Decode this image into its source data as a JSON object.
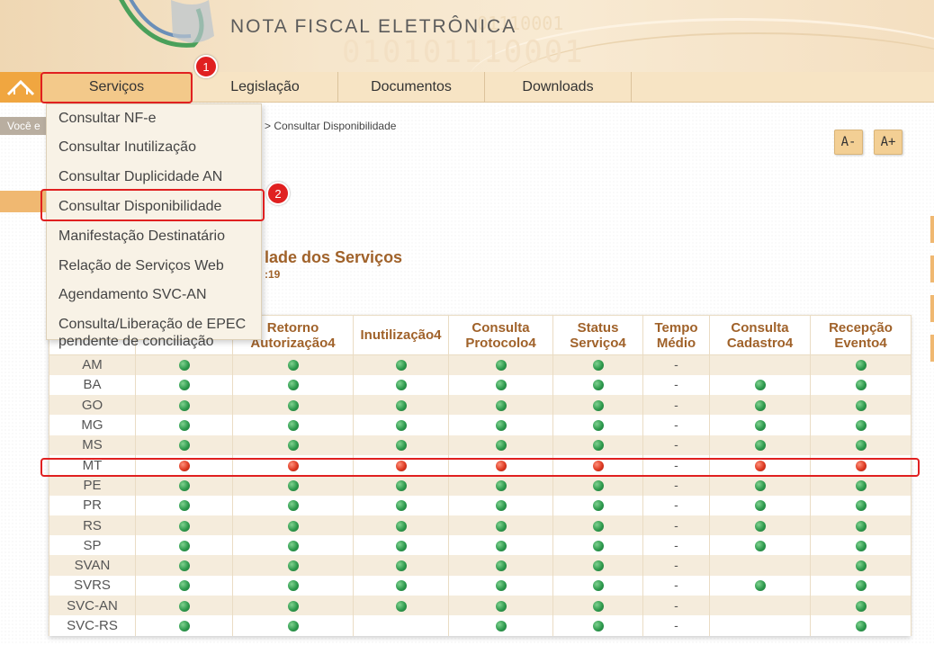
{
  "banner": {
    "title": "NOTA FISCAL ELETRÔNICA",
    "binary_large": "010101110001",
    "binary_small": "01110001"
  },
  "nav": {
    "items": [
      {
        "label": "Serviços",
        "active": true
      },
      {
        "label": "Legislação"
      },
      {
        "label": "Documentos"
      },
      {
        "label": "Downloads"
      }
    ]
  },
  "dropdown": {
    "items": [
      "Consultar NF-e",
      "Consultar Inutilização",
      "Consultar Duplicidade AN",
      "Consultar Disponibilidade",
      "Manifestação Destinatário",
      "Relação de Serviços Web",
      "Agendamento SVC-AN",
      "Consulta/Liberação de EPEC pendente de conciliação"
    ],
    "epec_line1": "Consulta/Liberação de EPEC",
    "epec_line2": "pendente de conciliação"
  },
  "breadcrumb": {
    "you_are": "Você e",
    "current": "> Consultar Disponibilidade"
  },
  "font_controls": {
    "decrease": "A-",
    "increase": "A+"
  },
  "page": {
    "heading": "lade dos Serviços",
    "sub": ":19"
  },
  "table": {
    "columns": [
      "",
      "",
      "Retorno Autorização4",
      "Inutilização4",
      "Consulta Protocolo4",
      "Status Serviço4",
      "Tempo Médio",
      "Consulta Cadastro4",
      "Recepção Evento4"
    ],
    "rows": [
      {
        "state": "AM",
        "cells": [
          "g",
          "g",
          "g",
          "g",
          "g",
          "-",
          "",
          "g"
        ]
      },
      {
        "state": "BA",
        "cells": [
          "g",
          "g",
          "g",
          "g",
          "g",
          "-",
          "g",
          "g"
        ]
      },
      {
        "state": "GO",
        "cells": [
          "g",
          "g",
          "g",
          "g",
          "g",
          "-",
          "g",
          "g"
        ]
      },
      {
        "state": "MG",
        "cells": [
          "g",
          "g",
          "g",
          "g",
          "g",
          "-",
          "g",
          "g"
        ]
      },
      {
        "state": "MS",
        "cells": [
          "g",
          "g",
          "g",
          "g",
          "g",
          "-",
          "g",
          "g"
        ]
      },
      {
        "state": "MT",
        "cells": [
          "r",
          "r",
          "r",
          "r",
          "r",
          "-",
          "r",
          "r"
        ]
      },
      {
        "state": "PE",
        "cells": [
          "g",
          "g",
          "g",
          "g",
          "g",
          "-",
          "g",
          "g"
        ]
      },
      {
        "state": "PR",
        "cells": [
          "g",
          "g",
          "g",
          "g",
          "g",
          "-",
          "g",
          "g"
        ]
      },
      {
        "state": "RS",
        "cells": [
          "g",
          "g",
          "g",
          "g",
          "g",
          "-",
          "g",
          "g"
        ]
      },
      {
        "state": "SP",
        "cells": [
          "g",
          "g",
          "g",
          "g",
          "g",
          "-",
          "g",
          "g"
        ]
      },
      {
        "state": "SVAN",
        "cells": [
          "g",
          "g",
          "g",
          "g",
          "g",
          "-",
          "",
          "g"
        ]
      },
      {
        "state": "SVRS",
        "cells": [
          "g",
          "g",
          "g",
          "g",
          "g",
          "-",
          "g",
          "g"
        ]
      },
      {
        "state": "SVC-AN",
        "cells": [
          "g",
          "g",
          "g",
          "g",
          "g",
          "-",
          "",
          "g"
        ]
      },
      {
        "state": "SVC-RS",
        "cells": [
          "g",
          "g",
          "",
          "g",
          "g",
          "-",
          "",
          "g"
        ]
      }
    ]
  },
  "annotations": {
    "badge1": "1",
    "badge2": "2"
  },
  "colors": {
    "green_status": "#2e9a4d",
    "red_status": "#dd3a22",
    "accent": "#a0622a",
    "highlight": "#e02020"
  }
}
